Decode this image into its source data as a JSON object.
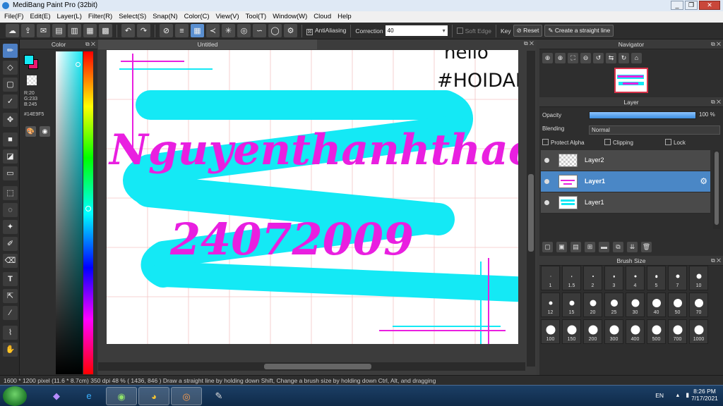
{
  "app": {
    "title": "MediBang Paint Pro (32bit)"
  },
  "window_controls": [
    "_",
    "❐",
    "✕"
  ],
  "menu": [
    "File(F)",
    "Edit(E)",
    "Layer(L)",
    "Filter(R)",
    "Select(S)",
    "Snap(N)",
    "Color(C)",
    "View(V)",
    "Tool(T)",
    "Window(W)",
    "Cloud",
    "Help"
  ],
  "toolbar": {
    "antialiasing_label": "AntiAliasing",
    "antialiasing_checked": "☒",
    "correction_label": "Correction",
    "correction_value": "40",
    "soft_edge_label": "Soft Edge",
    "key_label": "Key",
    "reset_label": "Reset",
    "straight_line_label": "Create a straight line"
  },
  "color_panel": {
    "title": "Color",
    "r": "R:20",
    "g": "G:233",
    "b": "B:245",
    "hex": "#14E9F5",
    "fg_color": "#14e9f5",
    "bg_color": "#e9176f"
  },
  "document": {
    "tab_title": "Untitled",
    "canvas_text_top": "hello",
    "canvas_hashtag": "#HOIDAP",
    "canvas_name": "Nguyenthanhthao",
    "canvas_date": "24072009"
  },
  "navigator": {
    "title": "Navigator"
  },
  "layer_panel": {
    "title": "Layer",
    "opacity_label": "Opacity",
    "opacity_value": "100 %",
    "blending_label": "Blending",
    "blending_value": "Normal",
    "protect_alpha_label": "Protect Alpha",
    "clipping_label": "Clipping",
    "lock_label": "Lock",
    "layers": [
      {
        "name": "Layer2"
      },
      {
        "name": "Layer1"
      },
      {
        "name": "Layer1"
      }
    ]
  },
  "brush_size": {
    "title": "Brush Size",
    "sizes": [
      "1",
      "1.5",
      "2",
      "3",
      "4",
      "5",
      "7",
      "10",
      "12",
      "15",
      "20",
      "25",
      "30",
      "40",
      "50",
      "70",
      "100",
      "150",
      "200",
      "300",
      "400",
      "500",
      "700",
      "1000"
    ]
  },
  "status": {
    "dims": "1600 * 1200 pixel",
    "cm": "(11.6 * 8.7cm)",
    "dpi": "350 dpi",
    "zoom": "48 %",
    "coords": "( 1436, 846 )",
    "hint": "Draw a straight line by holding down Shift, Change a brush size by holding down Ctrl, Alt, and dragging"
  },
  "taskbar": {
    "lang": "EN",
    "time": "8:26 PM",
    "date": "7/17/2021"
  }
}
